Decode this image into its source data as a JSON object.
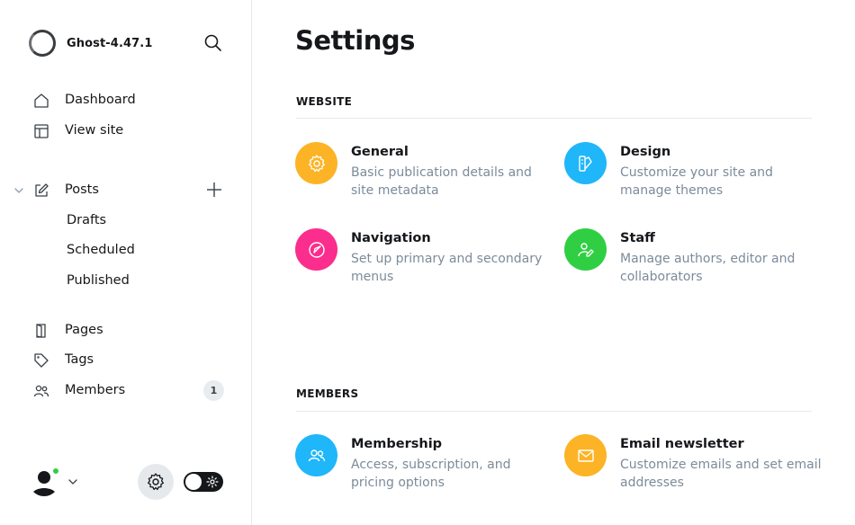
{
  "sidebar": {
    "brand": {
      "name": "Ghost-4.47.1"
    },
    "nav": {
      "dashboard": "Dashboard",
      "view_site": "View site",
      "posts": "Posts",
      "drafts": "Drafts",
      "scheduled": "Scheduled",
      "published": "Published",
      "pages": "Pages",
      "tags": "Tags",
      "members": "Members",
      "members_count": "1"
    }
  },
  "main": {
    "title": "Settings",
    "sections": {
      "website": {
        "title": "WEBSITE",
        "items": [
          {
            "title": "General",
            "description": "Basic publication details and site metadata",
            "icon": "gear-icon",
            "color": "#fcb325"
          },
          {
            "title": "Design",
            "description": "Customize your site and manage themes",
            "icon": "paint-palette-icon",
            "color": "#1fb6fa"
          },
          {
            "title": "Navigation",
            "description": "Set up primary and secondary menus",
            "icon": "compass-icon",
            "color": "#fb2d8d"
          },
          {
            "title": "Staff",
            "description": "Manage authors, editor and collaborators",
            "icon": "user-edit-icon",
            "color": "#30cf43"
          }
        ]
      },
      "members": {
        "title": "MEMBERS",
        "items": [
          {
            "title": "Membership",
            "description": "Access, subscription, and pricing options",
            "icon": "users-icon",
            "color": "#1fb6fa"
          },
          {
            "title": "Email newsletter",
            "description": "Customize emails and set email addresses",
            "icon": "envelope-icon",
            "color": "#fcb325"
          }
        ]
      }
    }
  },
  "colors": {
    "online": "#30cf43",
    "muted_text": "#7c8b9a",
    "border": "#e6e9eb"
  }
}
